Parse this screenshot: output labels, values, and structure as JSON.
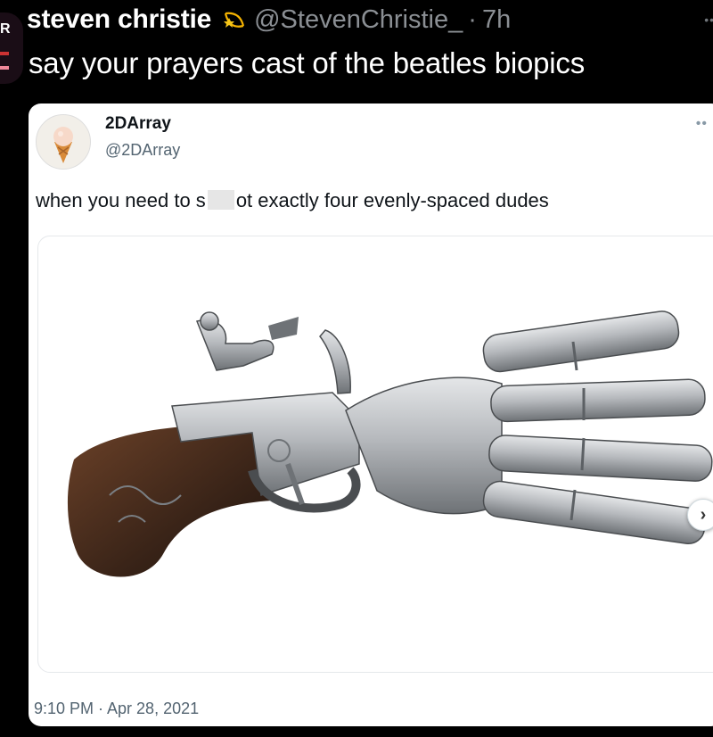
{
  "tweet": {
    "author_name": "steven christie",
    "author_handle": "@StevenChristie_",
    "separator": "·",
    "time": "7h",
    "text": "say your prayers cast of the beatles biopics",
    "badge_icon": "shooting-star-icon"
  },
  "quoted": {
    "name": "2DArray",
    "handle": "@2DArray",
    "text_before": "when you need to s",
    "text_after": "ot exactly four evenly-spaced dudes",
    "avatar_icon": "ice-cream-cone-icon",
    "image_subject": "duck-foot-flintlock-pistol",
    "timestamp": "9:10 PM · Apr 28, 2021"
  },
  "colors": {
    "background": "#000000",
    "card": "#ffffff",
    "muted": "#536471",
    "steel": "#b9bcc0",
    "wood": "#3a2418"
  }
}
